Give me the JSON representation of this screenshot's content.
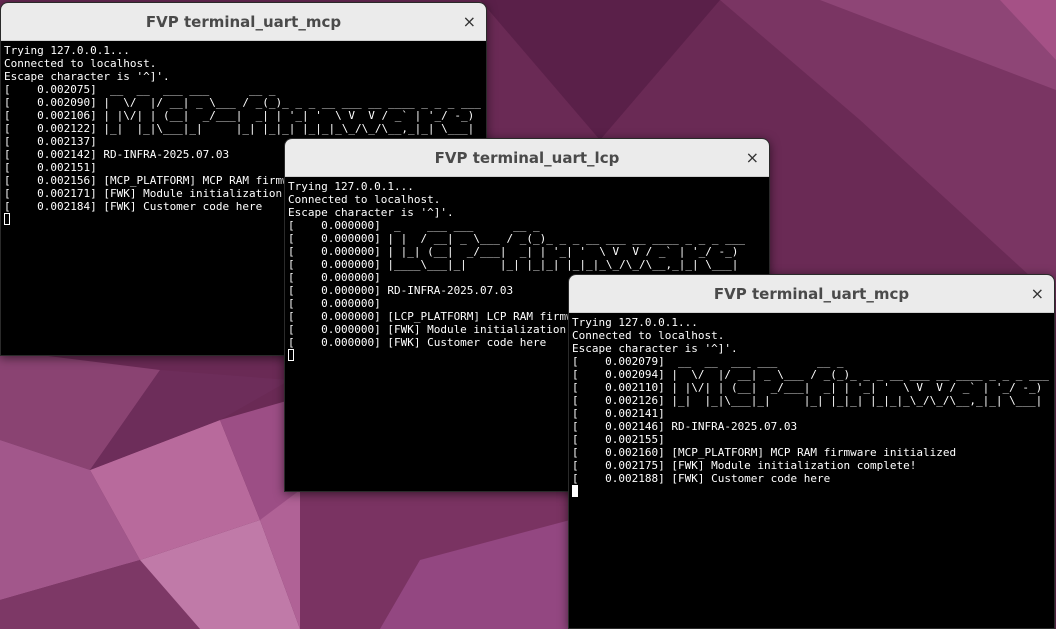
{
  "desktop": {
    "background": "#6a2a55"
  },
  "windows": [
    {
      "title": "FVP terminal_uart_mcp",
      "close": "×",
      "lines": [
        "Trying 127.0.0.1...",
        "Connected to localhost.",
        "Escape character is '^]'.",
        "[    0.002075]  __  __  ___ ___      __ _",
        "[    0.002090] |  \\/  |/ __| _ \\___ / _(_)_ _ _ __ ___ __ ____ _ _ _ ___",
        "[    0.002106] | |\\/| | (__|  _/___|  _| | '_| '  \\ V  V / _` | '_/ -_)",
        "[    0.002122] |_|  |_|\\___|_|     |_| |_|_| |_|_|_\\_/\\_/\\__,_|_| \\___|",
        "[    0.002137]",
        "[    0.002142] RD-INFRA-2025.07.03",
        "[    0.002151]",
        "[    0.002156] [MCP_PLATFORM] MCP RAM firmware initialized",
        "[    0.002171] [FWK] Module initialization complete!",
        "[    0.002184] [FWK] Customer code here"
      ]
    },
    {
      "title": "FVP terminal_uart_lcp",
      "close": "×",
      "lines": [
        "Trying 127.0.0.1...",
        "Connected to localhost.",
        "Escape character is '^]'.",
        "[    0.000000]  _    ___ ___      __ _",
        "[    0.000000] | |  / __| _ \\___ / _(_)_ _ _ __ ___ __ ____ _ _ _ ___",
        "[    0.000000] | |_| (__|  _/___|  _| | '_| '  \\ V  V / _` | '_/ -_)",
        "[    0.000000] |____\\___|_|     |_| |_|_| |_|_|_\\_/\\_/\\__,_|_| \\___|",
        "[    0.000000]",
        "[    0.000000] RD-INFRA-2025.07.03",
        "[    0.000000]",
        "[    0.000000] [LCP_PLATFORM] LCP RAM firmware initialized",
        "[    0.000000] [FWK] Module initialization complete!",
        "[    0.000000] [FWK] Customer code here"
      ]
    },
    {
      "title": "FVP terminal_uart_mcp",
      "close": "×",
      "lines": [
        "Trying 127.0.0.1...",
        "Connected to localhost.",
        "Escape character is '^]'.",
        "[    0.002079]  __  __  ___ ___      __ _",
        "[    0.002094] |  \\/  |/ __| _ \\___ / _(_)_ _ _ __ ___ __ ____ _ _ _ ___",
        "[    0.002110] | |\\/| | (__|  _/___|  _| | '_| '  \\ V  V / _` | '_/ -_)",
        "[    0.002126] |_|  |_|\\___|_|     |_| |_|_| |_|_|_\\_/\\_/\\__,_|_| \\___|",
        "[    0.002141]",
        "[    0.002146] RD-INFRA-2025.07.03",
        "[    0.002155]",
        "[    0.002160] [MCP_PLATFORM] MCP RAM firmware initialized",
        "[    0.002175] [FWK] Module initialization complete!",
        "[    0.002188] [FWK] Customer code here"
      ]
    }
  ]
}
